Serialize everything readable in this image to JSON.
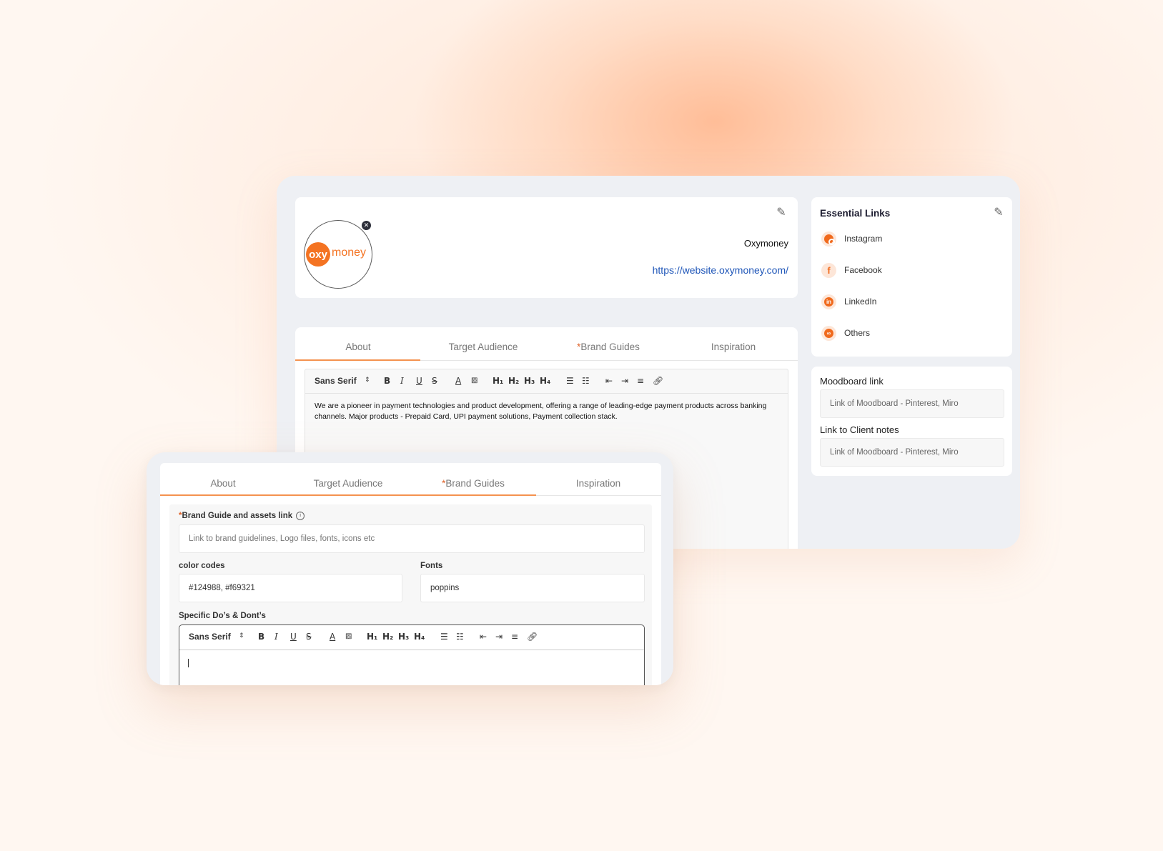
{
  "brand": {
    "logo_left": "oxy",
    "logo_right": "money",
    "name": "Oxymoney",
    "url": "https://website.oxymoney.com/"
  },
  "tabs": [
    "About",
    "Target Audience",
    "Brand Guides",
    "Inspiration"
  ],
  "required_mark": "*",
  "editor": {
    "font": "Sans Serif",
    "about_text": "We are a pioneer in payment technologies and product development, offering a range of leading-edge payment products across banking channels. Major products - Prepaid Card, UPI payment solutions, Payment collection stack."
  },
  "toolbar": {
    "bold": "B",
    "italic": "I",
    "underline": "U",
    "strike": "S",
    "color": "A",
    "h1": "H₁",
    "h2": "H₂",
    "h3": "H₃",
    "h4": "H₄"
  },
  "essential_links": {
    "title": "Essential Links",
    "items": [
      "Instagram",
      "Facebook",
      "LinkedIn",
      "Others"
    ]
  },
  "moodboard": {
    "label": "Moodboard link",
    "placeholder": "Link of Moodboard - Pinterest, Miro",
    "client_label": "Link to Client notes",
    "client_placeholder": "Link of Moodboard - Pinterest, Miro"
  },
  "brand_guides": {
    "assets_label": "Brand Guide and assets link",
    "assets_placeholder": "Link to brand guidelines, Logo files, fonts, icons etc",
    "color_label": "color codes",
    "color_value": "#124988, #f69321",
    "fonts_label": "Fonts",
    "fonts_value": "poppins",
    "dos_label": "Specific Do’s & Dont’s"
  },
  "colors": {
    "accent": "#f47322",
    "link": "#1f56b8"
  }
}
